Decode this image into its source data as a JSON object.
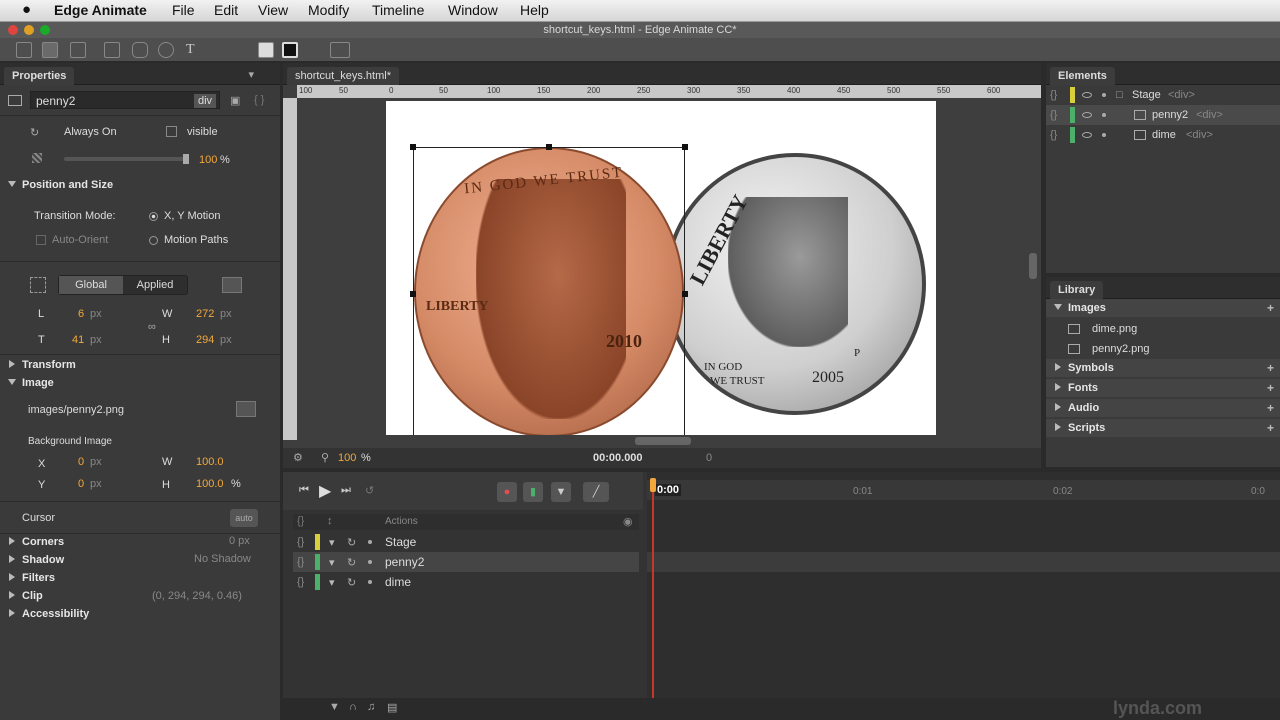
{
  "menubar": {
    "apple": "",
    "app_name": "Edge Animate",
    "items": [
      "File",
      "Edit",
      "View",
      "Modify",
      "Timeline",
      "Window",
      "Help"
    ]
  },
  "window_title": "shortcut_keys.html - Edge Animate CC*",
  "properties": {
    "tab": "Properties",
    "element_name": "penny2",
    "element_type": "div",
    "always_on": "Always On",
    "visible": "visible",
    "opacity": "100",
    "opacity_unit": "%",
    "position_size": "Position and Size",
    "transition_mode_label": "Transition Mode:",
    "xy_motion": "X, Y Motion",
    "auto_orient": "Auto-Orient",
    "motion_paths": "Motion Paths",
    "global": "Global",
    "applied": "Applied",
    "l_label": "L",
    "l_value": "6",
    "t_label": "T",
    "t_value": "41",
    "w_label": "W",
    "w_value": "272",
    "h_label": "H",
    "h_value": "294",
    "px": "px",
    "transform": "Transform",
    "image": "Image",
    "image_path": "images/penny2.png",
    "background_image": "Background Image",
    "bg_x_label": "X",
    "bg_x": "0",
    "bg_y_label": "Y",
    "bg_y": "0",
    "bg_w_label": "W",
    "bg_w": "100.0",
    "bg_h_label": "H",
    "bg_h": "100.0",
    "bg_h_unit": "%",
    "cursor": "Cursor",
    "cursor_value": "auto",
    "corners": "Corners",
    "corners_value": "0 px",
    "shadow": "Shadow",
    "shadow_value": "No Shadow",
    "filters": "Filters",
    "clip": "Clip",
    "clip_value": "(0, 294, 294, 0.46)",
    "accessibility": "Accessibility"
  },
  "stage": {
    "tab": "shortcut_keys.html*",
    "ruler_labels": [
      "0",
      "50",
      "100",
      "150",
      "200",
      "250",
      "300",
      "350",
      "400",
      "450",
      "500",
      "550",
      "600"
    ],
    "ruler_neg": [
      "100",
      "50"
    ],
    "zoom": "100",
    "zoom_unit": "%",
    "time": "00:00.000",
    "time_offset": "0"
  },
  "penny": {
    "motto": "IN GOD WE TRUST",
    "liberty": "LIBERTY",
    "year": "2010"
  },
  "dime": {
    "liberty": "LIBERTY",
    "motto_1": "IN GOD",
    "motto_2": "WE TRUST",
    "year": "2005",
    "mint": "P"
  },
  "elements": {
    "tab": "Elements",
    "items": [
      {
        "name": "Stage",
        "tag": "<div>"
      },
      {
        "name": "penny2",
        "tag": "<div>"
      },
      {
        "name": "dime",
        "tag": "<div>"
      }
    ]
  },
  "library": {
    "tab": "Library",
    "images_label": "Images",
    "images": [
      "dime.png",
      "penny2.png"
    ],
    "sections": [
      "Symbols",
      "Fonts",
      "Audio",
      "Scripts"
    ]
  },
  "timeline": {
    "actions": "Actions",
    "time_marks": [
      "0:00",
      "0:01",
      "0:02",
      "0:0"
    ],
    "tracks": [
      "Stage",
      "penny2",
      "dime"
    ],
    "colors": {
      "stage": "#d8d03a",
      "penny2": "#4caf6a",
      "dime": "#4caf6a",
      "playhead": "#c0392b",
      "accent": "#f2a83b"
    }
  },
  "watermark": "lynda.com"
}
